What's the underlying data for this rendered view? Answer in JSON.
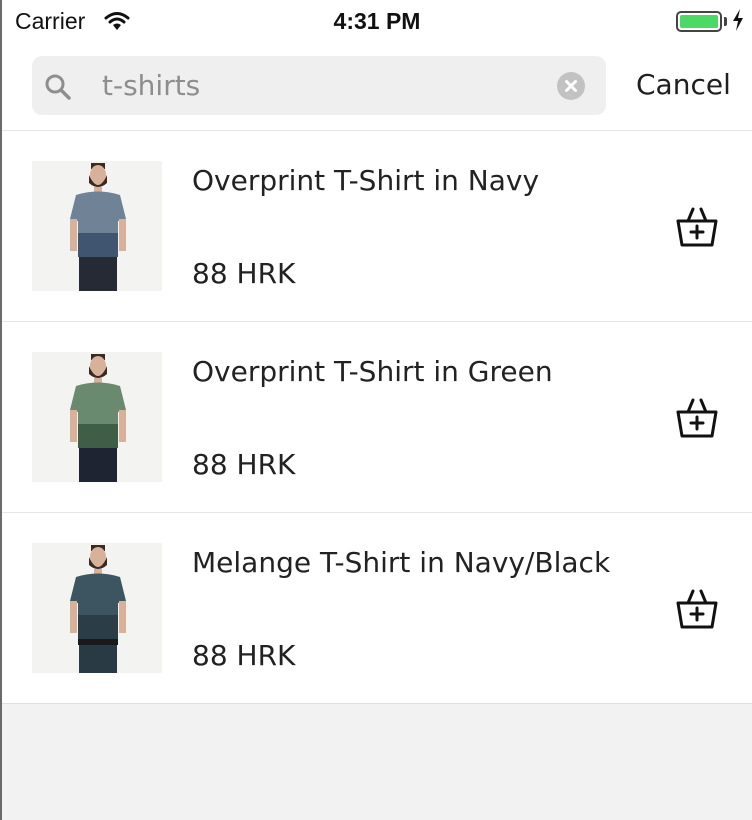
{
  "status_bar": {
    "carrier": "Carrier",
    "time": "4:31 PM",
    "battery_color": "#4cd964"
  },
  "search": {
    "query": "t-shirts",
    "search_icon": "search-icon",
    "clear_icon": "clear-icon",
    "cancel_label": "Cancel"
  },
  "results": [
    {
      "name": "Overprint T-Shirt in Navy",
      "price": "88 HRK",
      "shirt_color": "#6f8296",
      "shirt_color_bottom": "#3f5570",
      "action_icon": "add-to-basket-icon"
    },
    {
      "name": "Overprint T-Shirt in Green",
      "price": "88 HRK",
      "shirt_color": "#6a8a70",
      "shirt_color_bottom": "#3f5e47",
      "action_icon": "add-to-basket-icon"
    },
    {
      "name": "Melange T-Shirt in Navy/Black",
      "price": "88 HRK",
      "shirt_color": "#3d5560",
      "shirt_color_bottom": "#2b3d46",
      "action_icon": "add-to-basket-icon"
    }
  ],
  "colors": {
    "background": "#f2f2f2",
    "text": "#222222",
    "placeholder": "#8e8e8e"
  }
}
